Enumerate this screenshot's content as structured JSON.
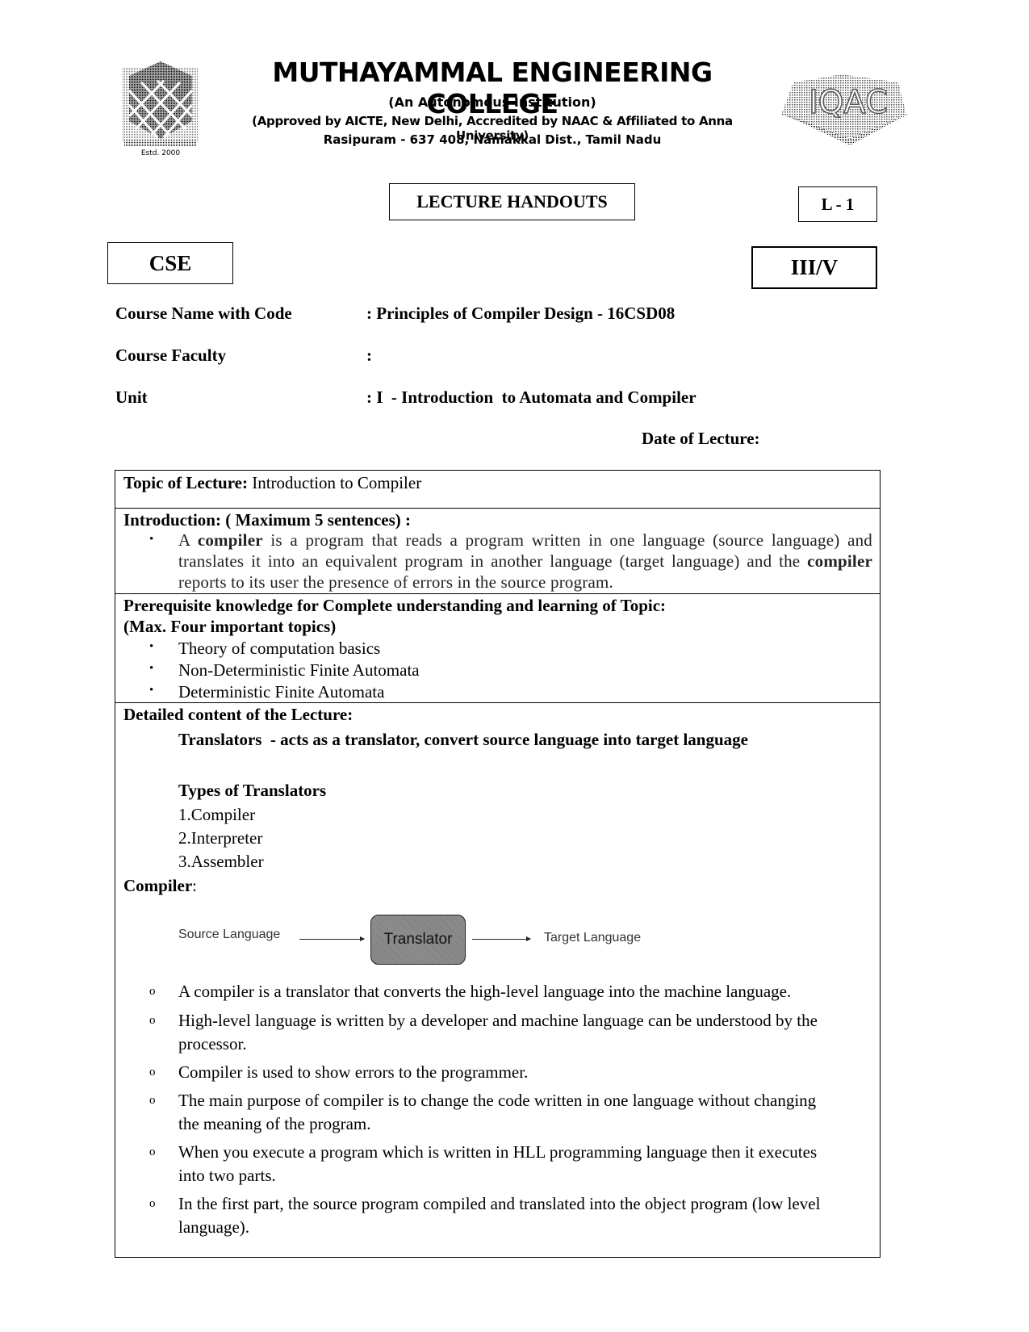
{
  "header": {
    "college_name": "MUTHAYAMMAL ENGINEERING COLLEGE",
    "subtitle": "(An Autonomous Institution)",
    "approval": "(Approved by AICTE, New Delhi, Accredited by NAAC & Affiliated to Anna University)",
    "address": "Rasipuram - 637 408, Namakkal Dist., Tamil Nadu",
    "logo_left_caption": "Estd. 2000",
    "logo_right_text": "IQAC"
  },
  "boxes": {
    "title": "LECTURE HANDOUTS",
    "lecture_no": "L - 1",
    "department": "CSE",
    "year_sem": "III/V"
  },
  "meta": {
    "course_label": "Course Name with Code",
    "course_value": ": Principles of Compiler Design - 16CSD08",
    "faculty_label": "Course Faculty",
    "faculty_value": ":",
    "unit_label": "Unit",
    "unit_value": ": I  - Introduction  to Automata and Compiler",
    "date_label": "Date of Lecture:"
  },
  "table": {
    "topic_label": "Topic of Lecture:",
    "topic_value": " Introduction to Compiler",
    "intro_label": "Introduction:  ( Maximum 5 sentences) :",
    "intro_bullet": "•",
    "intro_parts": [
      "A ",
      "compiler",
      " is a program that reads a program written in one language (source language) and translates it into an equivalent program in another language (target language) and the ",
      "compiler",
      " reports to its user the presence of errors in the source program."
    ],
    "prereq_label_1": "Prerequisite knowledge for Complete understanding and learning of Topic:",
    "prereq_label_2": "(Max. Four important topics)",
    "prereq_items": [
      "Theory of computation basics",
      "Non-Deterministic Finite Automata",
      "Deterministic Finite Automata"
    ],
    "detail_label": "Detailed content of the Lecture:",
    "translators_line": "Translators  - acts as a translator, convert source language into target language",
    "types_heading": "Types of Translators",
    "types": [
      "1.Compiler",
      "2.Interpreter",
      "3.Assembler"
    ],
    "compiler_heading": "Compiler",
    "compiler_colon": ":",
    "diagram": {
      "source": "Source Language",
      "box": "Translator",
      "target": "Target Language"
    },
    "bullet_symbol": "o",
    "compiler_points": [
      [
        "A compiler is a translator that converts the high-level language into the machine language."
      ],
      [
        "High-level language is written by a developer and machine language can be understood by the",
        "processor."
      ],
      [
        "Compiler is used to show errors to the programmer."
      ],
      [
        "The main purpose of compiler is to change the code written in one language without changing",
        "the meaning of the program."
      ],
      [
        "When you execute a program which is written in HLL programming language then it executes",
        "into two parts."
      ],
      [
        "In the first part, the source program compiled and translated into the object program (low level",
        "language)."
      ]
    ]
  }
}
